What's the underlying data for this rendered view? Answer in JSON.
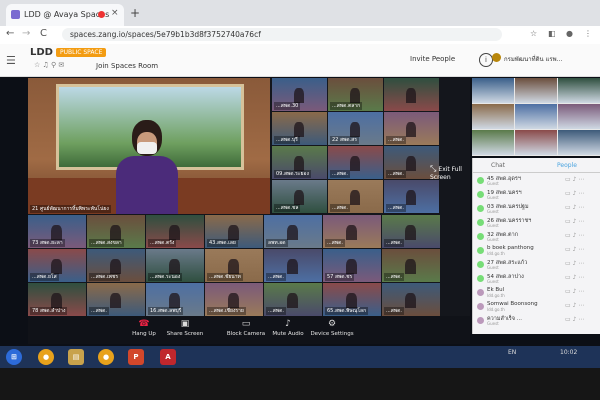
{
  "browser": {
    "tab_title": "LDD @ Avaya Spaces",
    "tab_close": "×",
    "new_tab": "+",
    "back": "←",
    "forward": "→",
    "reload": "C",
    "url": "spaces.zang.io/spaces/5e79b1b3d8f3752740a76cf"
  },
  "app": {
    "space_name": "LDD",
    "space_badge": "PUBLIC SPACE",
    "join_label": "Join Spaces Room",
    "invite_label": "Invite People",
    "user_name": "กรมพัฒนาที่ดิน แรพ...",
    "user_sub": "ldd.go.th"
  },
  "main_video": {
    "caption": "21 ศูนย์พัฒนาการหิ้มพิพระพันโน่ยง"
  },
  "tiles": [
    {
      "caption": "...สพด.30"
    },
    {
      "caption": "...สพด.ตลาก"
    },
    {
      "caption": "Exit Full Screen"
    },
    {
      "caption": "...สพด.บุรี"
    },
    {
      "caption": "22 สพด.สร"
    },
    {
      "caption": "...สพด."
    },
    {
      "caption": "09.สพด.ระยอง"
    },
    {
      "caption": "...สพด."
    },
    {
      "caption": "...สพด."
    },
    {
      "caption": "...สพด.ชล"
    },
    {
      "caption": "...สพด."
    },
    {
      "caption": "...สพด."
    },
    {
      "caption": "73 สพด.ยะลา"
    },
    {
      "caption": "...สพด.สงขลา"
    },
    {
      "caption": "...สพด.ตรัง"
    },
    {
      "caption": "43.สพด.เลย"
    },
    {
      "caption": "ลพท.อด"
    },
    {
      "caption": "...สพด."
    },
    {
      "caption": "...สพด."
    },
    {
      "caption": "...สพด.ยโส"
    },
    {
      "caption": "...สพด.เพชร"
    },
    {
      "caption": "...สพด.ระนอง"
    },
    {
      "caption": "...สพด.ชัยนาท"
    },
    {
      "caption": "...สพด."
    },
    {
      "caption": "57 สพด.ชร"
    },
    {
      "caption": "...สพด."
    },
    {
      "caption": "78 สพด.ลำปาง"
    },
    {
      "caption": "...สพด."
    },
    {
      "caption": "16.สพด.ลพบุรี"
    },
    {
      "caption": "...สพด.เชียงราย"
    },
    {
      "caption": "...สพด."
    },
    {
      "caption": "65.สพด.พิษณุโลก"
    },
    {
      "caption": "...สพด."
    },
    {
      "caption": "...สพด.แพร่"
    },
    {
      "caption": "...สพด."
    },
    {
      "caption": "17.สพด.สิงห์บุรี"
    },
    {
      "caption": "...สพด.พัทลุง"
    },
    {
      "caption": "...สพด."
    },
    {
      "caption": "...สพด.นครปฐม"
    },
    {
      "caption": "...สพด."
    }
  ],
  "controls": {
    "hangup": "Hang Up",
    "share": "Share Screen",
    "block_camera": "Block Camera",
    "mute": "Mute Audio",
    "devices": "Device Settings",
    "exit_fullscreen": "Exit Full Screen"
  },
  "panel": {
    "tab_chat": "Chat",
    "tab_people": "People",
    "people": [
      {
        "name": "45 สพด.อุดรฯ",
        "sub": "Guest"
      },
      {
        "name": "19 สพด.นครฯ",
        "sub": "Guest"
      },
      {
        "name": "03 สพด.นครปฐม",
        "sub": "Guest"
      },
      {
        "name": "26 สพด.นครราชฯ",
        "sub": "Guest"
      },
      {
        "name": "32 สพด.ตาก",
        "sub": "Guest"
      },
      {
        "name": "b boek panthong",
        "sub": "ldd.go.th"
      },
      {
        "name": "27 สพด.สระแก้ว",
        "sub": "Guest"
      },
      {
        "name": "54 สพด.ลาปาง",
        "sub": "Guest"
      },
      {
        "name": "Ek Bul",
        "sub": "ldd.go.th"
      },
      {
        "name": "Somwai Boonsong",
        "sub": "ldd.go.th"
      },
      {
        "name": "ความสำเร็จ ...",
        "sub": "Guest"
      }
    ]
  },
  "taskbar": {
    "lang": "EN",
    "time": "10:02"
  }
}
